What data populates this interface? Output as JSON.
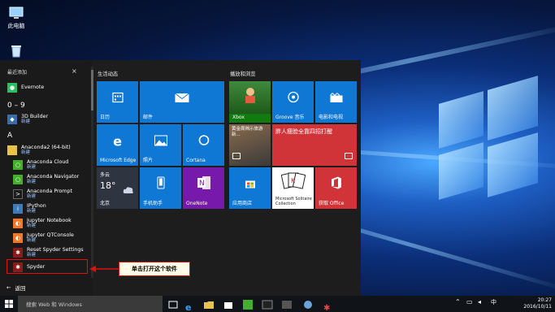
{
  "desktop": {
    "icons": [
      {
        "label": "此电脑",
        "icon": "this-pc-icon"
      },
      {
        "label": "",
        "icon": "recycle-bin-icon"
      }
    ]
  },
  "start_menu": {
    "recent_label": "最近添加",
    "close_glyph": "×",
    "apps": [
      {
        "name": "Evernote",
        "sub": "",
        "icon": "evernote-icon",
        "color": "#2dbe60"
      },
      {
        "group": "0 – 9"
      },
      {
        "name": "3D Builder",
        "sub": "新建",
        "icon": "3d-builder-icon",
        "color": "#3b6ea8"
      },
      {
        "group": "A"
      },
      {
        "name": "Anaconda2 (64-bit)",
        "sub": "新建",
        "icon": "folder-icon",
        "color": "#e8c34a"
      },
      {
        "name": "Anaconda Cloud",
        "sub": "新建",
        "icon": "anaconda-icon",
        "color": "#43b02a"
      },
      {
        "name": "Anaconda Navigator",
        "sub": "新建",
        "icon": "anaconda-icon",
        "color": "#43b02a"
      },
      {
        "name": "Anaconda Prompt",
        "sub": "新建",
        "icon": "prompt-icon",
        "color": "#1b1b1b"
      },
      {
        "name": "IPython",
        "sub": "新建",
        "icon": "ipython-icon",
        "color": "#3c7bb5"
      },
      {
        "name": "Jupyter Notebook",
        "sub": "新建",
        "icon": "jupyter-icon",
        "color": "#f37726"
      },
      {
        "name": "Jupyter QTConsole",
        "sub": "新建",
        "icon": "jupyter-icon",
        "color": "#f37726"
      },
      {
        "name": "Reset Spyder Settings",
        "sub": "新建",
        "icon": "spyder-icon",
        "color": "#8a1b1b"
      },
      {
        "name": "Spyder",
        "sub": "",
        "icon": "spyder-icon",
        "color": "#8a1b1b"
      }
    ],
    "back_label": "返回",
    "group_headers": {
      "left": "生活动态",
      "right": "播放和浏览"
    },
    "tiles": [
      {
        "label": "日历",
        "icon": "calendar-icon",
        "color": "#0e78d4"
      },
      {
        "label": "邮件",
        "icon": "mail-icon",
        "color": "#0e78d4"
      },
      {
        "label": "Microsoft Edge",
        "icon": "edge-icon",
        "color": "#0e78d4"
      },
      {
        "label": "照片",
        "icon": "photos-icon",
        "color": "#0e78d4"
      },
      {
        "label": "Cortana",
        "icon": "cortana-icon",
        "color": "#0e78d4"
      },
      {
        "label": "北京",
        "city": "多云",
        "temp": "18°",
        "icon": "weather-icon",
        "color": "#2e3440"
      },
      {
        "label": "手机助手",
        "icon": "phone-icon",
        "color": "#0e78d4"
      },
      {
        "label": "OneNote",
        "icon": "onenote-icon",
        "color": "#7719aa"
      },
      {
        "label": "Xbox",
        "icon": "xbox-icon",
        "color": "#107c10"
      },
      {
        "label": "Groove 音乐",
        "icon": "groove-icon",
        "color": "#0e78d4"
      },
      {
        "label": "电影和电视",
        "icon": "movies-icon",
        "color": "#0e78d4"
      },
      {
        "label": "",
        "caption": "黄金周揭示旅游新...",
        "icon": "news-icon",
        "color": "#555555"
      },
      {
        "label": "",
        "caption": "胖人瘦脸全靠四招打醒",
        "icon": "news-icon",
        "color": "#d13438"
      },
      {
        "label": "应用商店",
        "icon": "store-icon",
        "color": "#0e78d4"
      },
      {
        "label": "Microsoft Solitaire Collection",
        "icon": "solitaire-icon",
        "color": "#ffffff"
      },
      {
        "label": "获取 Office",
        "icon": "office-icon",
        "color": "#d13438"
      }
    ]
  },
  "annotation": {
    "callout": "单击打开这个软件"
  },
  "taskbar": {
    "search_placeholder": "搜索 Web 和 Windows",
    "time": "20:27",
    "date": "2016/10/11",
    "tray_lang": "中"
  }
}
